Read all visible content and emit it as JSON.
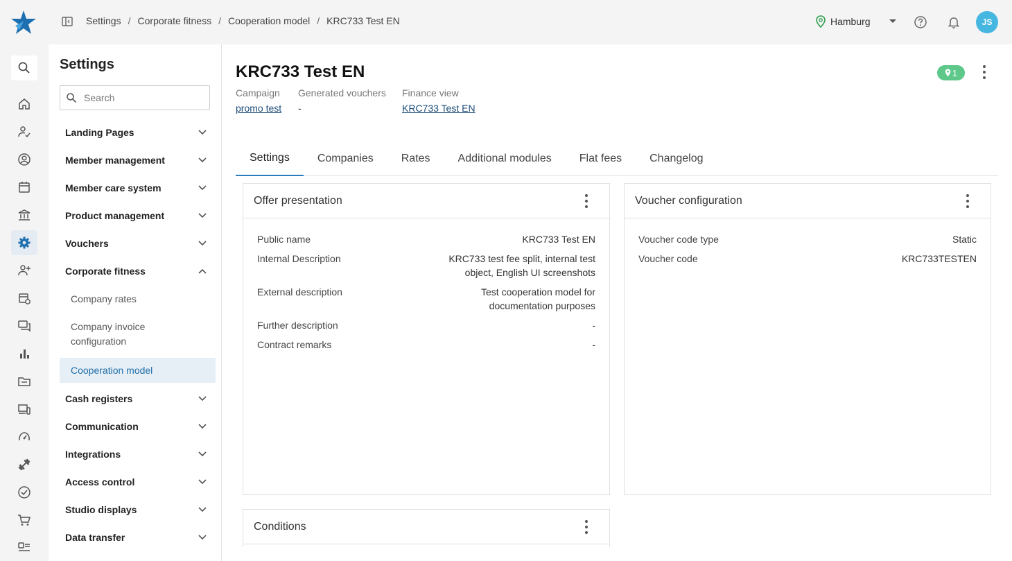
{
  "breadcrumb": [
    "Settings",
    "Corporate fitness",
    "Cooperation model",
    "KRC733 Test EN"
  ],
  "location": "Hamburg",
  "user_initials": "JS",
  "rail_icons": [
    "search-icon",
    "home-icon",
    "member-check-icon",
    "member-circle-icon",
    "calendar-icon",
    "bank-icon",
    "settings-gear-icon",
    "add-user-icon",
    "calendar-sync-icon",
    "chat-icon",
    "bar-chart-icon",
    "folder-icon",
    "devices-icon",
    "gauge-icon",
    "dumbbell-icon",
    "check-circle-icon",
    "cart-icon",
    "badge-icon"
  ],
  "settings": {
    "title": "Settings",
    "search_placeholder": "Search",
    "nav": [
      {
        "label": "Landing Pages",
        "expanded": false
      },
      {
        "label": "Member management",
        "expanded": false
      },
      {
        "label": "Member care system",
        "expanded": false
      },
      {
        "label": "Product management",
        "expanded": false
      },
      {
        "label": "Vouchers",
        "expanded": false
      },
      {
        "label": "Corporate fitness",
        "expanded": true
      }
    ],
    "sub_items": [
      "Company rates",
      "Company invoice configuration",
      "Cooperation model"
    ],
    "nav_after": [
      "Cash registers",
      "Communication",
      "Integrations",
      "Access control",
      "Studio displays",
      "Data transfer"
    ]
  },
  "page": {
    "title": "KRC733 Test EN",
    "badge_count": "1",
    "meta": [
      {
        "label": "Campaign",
        "value": "promo test",
        "link": true
      },
      {
        "label": "Generated vouchers",
        "value": "-",
        "link": false
      },
      {
        "label": "Finance view",
        "value": "KRC733 Test EN",
        "link": true
      }
    ],
    "tabs": [
      "Settings",
      "Companies",
      "Rates",
      "Additional modules",
      "Flat fees",
      "Changelog"
    ],
    "active_tab": "Settings"
  },
  "offer_card": {
    "title": "Offer presentation",
    "rows": [
      {
        "k": "Public name",
        "v": "KRC733 Test EN"
      },
      {
        "k": "Internal Description",
        "v": "KRC733 test fee split, internal test object, English UI screenshots"
      },
      {
        "k": "External description",
        "v": "Test cooperation model for documentation purposes"
      },
      {
        "k": "Further description",
        "v": "-"
      },
      {
        "k": "Contract remarks",
        "v": "-"
      }
    ]
  },
  "voucher_card": {
    "title": "Voucher configuration",
    "rows": [
      {
        "k": "Voucher code type",
        "v": "Static"
      },
      {
        "k": "Voucher code",
        "v": "KRC733TESTEN"
      }
    ]
  },
  "conditions_card": {
    "title": "Conditions"
  },
  "colors": {
    "accent": "#2b7cbf",
    "badge": "#5dc88a",
    "avatar": "#46b7e0",
    "logo": "#1e6fb0"
  }
}
